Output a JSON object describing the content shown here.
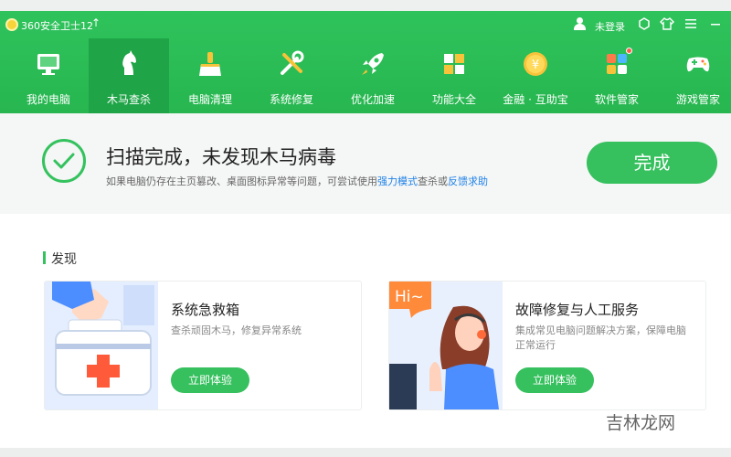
{
  "app": {
    "title": "360安全卫士12",
    "login_label": "未登录"
  },
  "nav": [
    {
      "label": "我的电脑",
      "icon": "computer-icon"
    },
    {
      "label": "木马查杀",
      "icon": "horse-icon",
      "active": true
    },
    {
      "label": "电脑清理",
      "icon": "broom-icon"
    },
    {
      "label": "系统修复",
      "icon": "tools-icon"
    },
    {
      "label": "优化加速",
      "icon": "rocket-icon"
    },
    {
      "label": "功能大全",
      "icon": "grid-icon"
    },
    {
      "label": "金融 · 互助宝",
      "icon": "coin-icon"
    },
    {
      "label": "软件管家",
      "icon": "apps-icon"
    },
    {
      "label": "游戏管家",
      "icon": "gamepad-icon"
    }
  ],
  "status": {
    "title": "扫描完成，未发现木马病毒",
    "desc_prefix": "如果电脑仍存在主页篡改、桌面图标异常等问题，可尝试使用",
    "link_mode": "强力模式",
    "desc_mid": "查杀或",
    "link_feedback": "反馈求助",
    "done_label": "完成"
  },
  "discover": {
    "section_title": "发现",
    "cards": [
      {
        "title": "系统急救箱",
        "desc": "查杀顽固木马，修复异常系统",
        "button": "立即体验"
      },
      {
        "title": "故障修复与人工服务",
        "desc": "集成常见电脑问题解决方案，保障电脑正常运行",
        "button": "立即体验"
      }
    ]
  },
  "watermark": "吉林龙网",
  "colors": {
    "brand_green": "#2fc35c",
    "active_nav": "#1fa447",
    "button_green": "#36c05e",
    "link_blue": "#1f82e8"
  }
}
